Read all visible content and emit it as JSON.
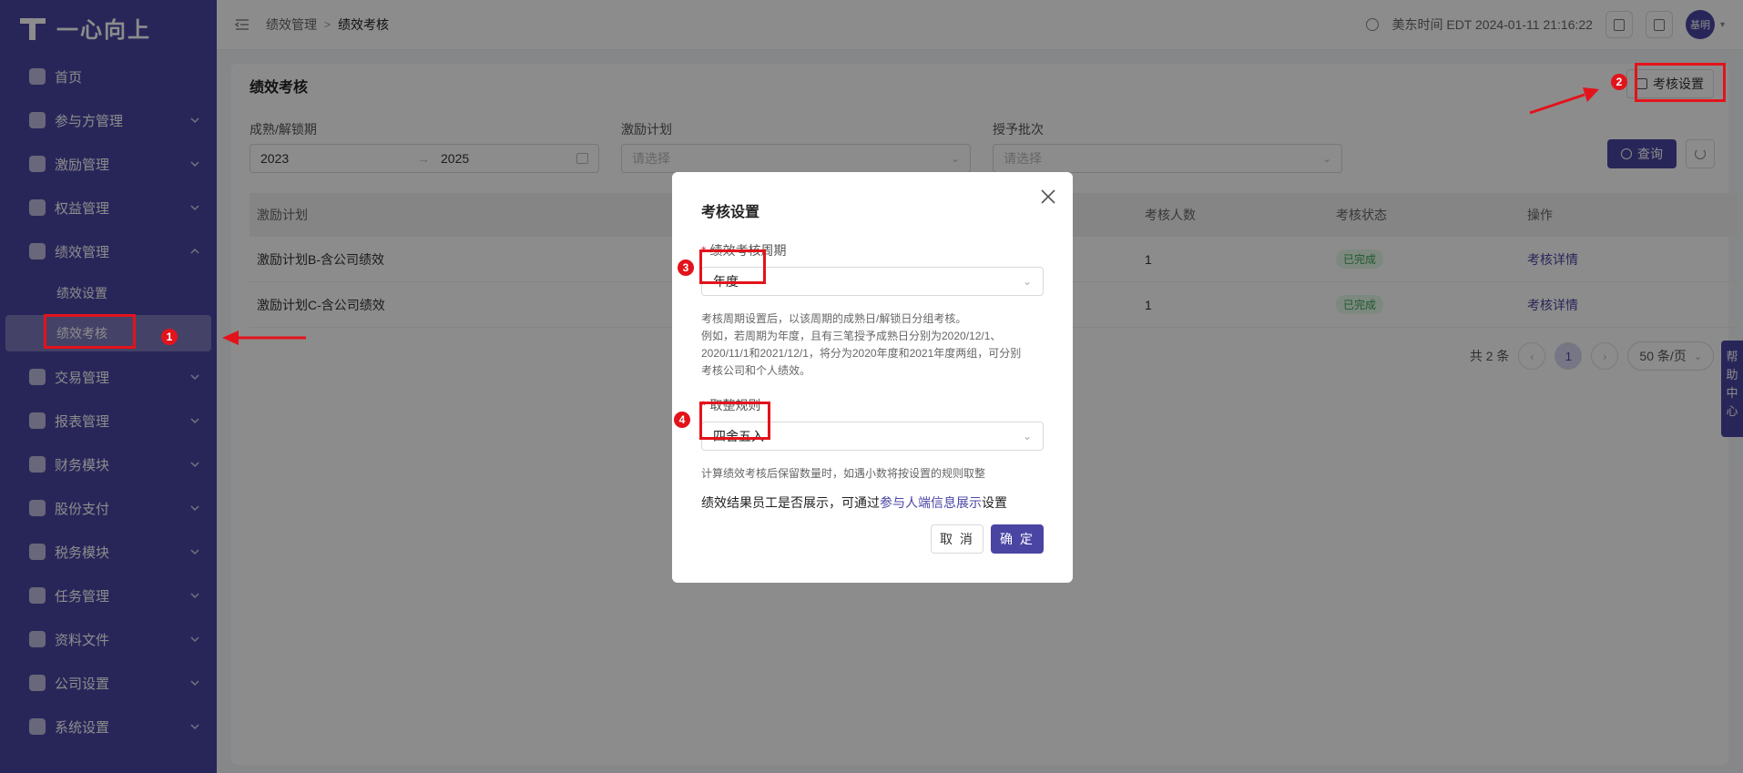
{
  "app": {
    "logo_text": "一心向上"
  },
  "sidebar": {
    "items": [
      {
        "label": "首页",
        "has_chevron": false
      },
      {
        "label": "参与方管理",
        "has_chevron": true
      },
      {
        "label": "激励管理",
        "has_chevron": true
      },
      {
        "label": "权益管理",
        "has_chevron": true
      },
      {
        "label": "绩效管理",
        "has_chevron": true,
        "expanded": true
      },
      {
        "label": "交易管理",
        "has_chevron": true
      },
      {
        "label": "报表管理",
        "has_chevron": true
      },
      {
        "label": "财务模块",
        "has_chevron": true
      },
      {
        "label": "股份支付",
        "has_chevron": true
      },
      {
        "label": "税务模块",
        "has_chevron": true
      },
      {
        "label": "任务管理",
        "has_chevron": true
      },
      {
        "label": "资料文件",
        "has_chevron": true
      },
      {
        "label": "公司设置",
        "has_chevron": true
      },
      {
        "label": "系统设置",
        "has_chevron": true
      }
    ],
    "sub_items": [
      {
        "label": "绩效设置"
      },
      {
        "label": "绩效考核",
        "active": true
      }
    ]
  },
  "header": {
    "breadcrumb": [
      "绩效管理",
      "绩效考核"
    ],
    "time": "美东时间 EDT 2024-01-11 21:16:22",
    "avatar": "基明"
  },
  "page": {
    "title": "绩效考核",
    "settings_button": "考核设置",
    "filters": {
      "period_label": "成熟/解锁期",
      "period_start": "2023",
      "period_end": "2025",
      "plan_label": "激励计划",
      "plan_placeholder": "请选择",
      "batch_label": "授予批次",
      "batch_placeholder": "请选择"
    },
    "query_button": "查询",
    "table": {
      "columns": [
        "激励计划",
        "考核人数",
        "考核状态",
        "操作"
      ],
      "rows": [
        {
          "plan": "激励计划B-含公司绩效",
          "count": "1",
          "status": "已完成",
          "action": "考核详情"
        },
        {
          "plan": "激励计划C-含公司绩效",
          "count": "1",
          "status": "已完成",
          "action": "考核详情"
        }
      ]
    },
    "pager": {
      "total": "共 2 条",
      "current": "1",
      "page_size": "50 条/页"
    },
    "help": [
      "帮",
      "助",
      "中",
      "心"
    ]
  },
  "modal": {
    "title": "考核设置",
    "period_label": "绩效考核周期",
    "period_value": "年度",
    "hint_lines": [
      "考核周期设置后，以该周期的成熟日/解锁日分组考核。",
      "例如，若周期为年度，且有三笔授予成熟日分别为2020/12/1、",
      "2020/11/1和2021/12/1，将分为2020年度和2021年度两组，可分别",
      "考核公司和个人绩效。"
    ],
    "rounding_label": "取整规则",
    "rounding_value": "四舍五入",
    "rounding_hint": "计算绩效考核后保留数量时，如遇小数将按设置的规则取整",
    "note_prefix": "绩效结果员工是否展示，可通过",
    "note_link": "参与人端信息展示",
    "note_suffix": "设置",
    "cancel": "取 消",
    "ok": "确 定"
  },
  "annotations": [
    "1",
    "2",
    "3",
    "4"
  ],
  "colors": {
    "brand": "#4a45a3",
    "annotation": "#e3131b",
    "success": "#3ea85a"
  }
}
